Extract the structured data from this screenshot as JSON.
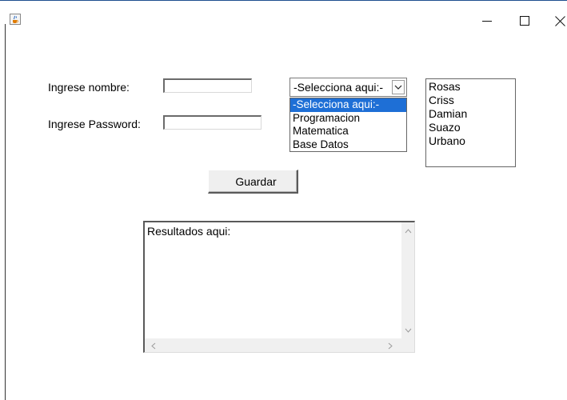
{
  "window": {
    "icon": "java-cup-icon",
    "controls": [
      "minimize-icon",
      "maximize-icon",
      "close-icon"
    ]
  },
  "form": {
    "nombre_label": "Ingrese nombre:",
    "nombre_value": "",
    "password_label": "Ingrese Password:",
    "password_value": ""
  },
  "combo": {
    "selected": "-Selecciona aqui:-",
    "options": [
      "-Selecciona aqui:-",
      "Programacion",
      "Matematica",
      "Base Datos"
    ]
  },
  "list": {
    "items": [
      "Rosas",
      "Criss",
      "Damian",
      "Suazo",
      "Urbano"
    ]
  },
  "buttons": {
    "guardar": "Guardar"
  },
  "results": {
    "text": "Resultados aqui:"
  },
  "colors": {
    "selection": "#1e6fd6",
    "title_line": "#1f4f8f"
  }
}
